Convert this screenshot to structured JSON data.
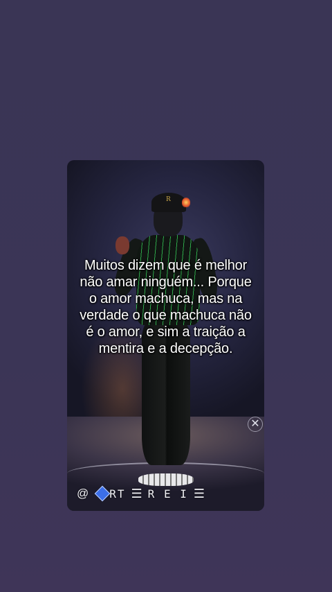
{
  "post": {
    "quote": "Muitos dizem que é melhor não amar ninguém... Porque o amor machuca, mas na verdade o que machuca não é o amor, e sim a traição a mentira e a decepção.",
    "watermark": {
      "at": "@",
      "name_1": "RT",
      "sep_1": "☰",
      "name_2": "R E I",
      "sep_2": "☰"
    },
    "side_icon": "✕"
  },
  "colors": {
    "background": "#3a3555",
    "text": "#ffffff",
    "shirt_stripe": "#2ea84a",
    "watermark_diamond": "#3c6fe8"
  }
}
